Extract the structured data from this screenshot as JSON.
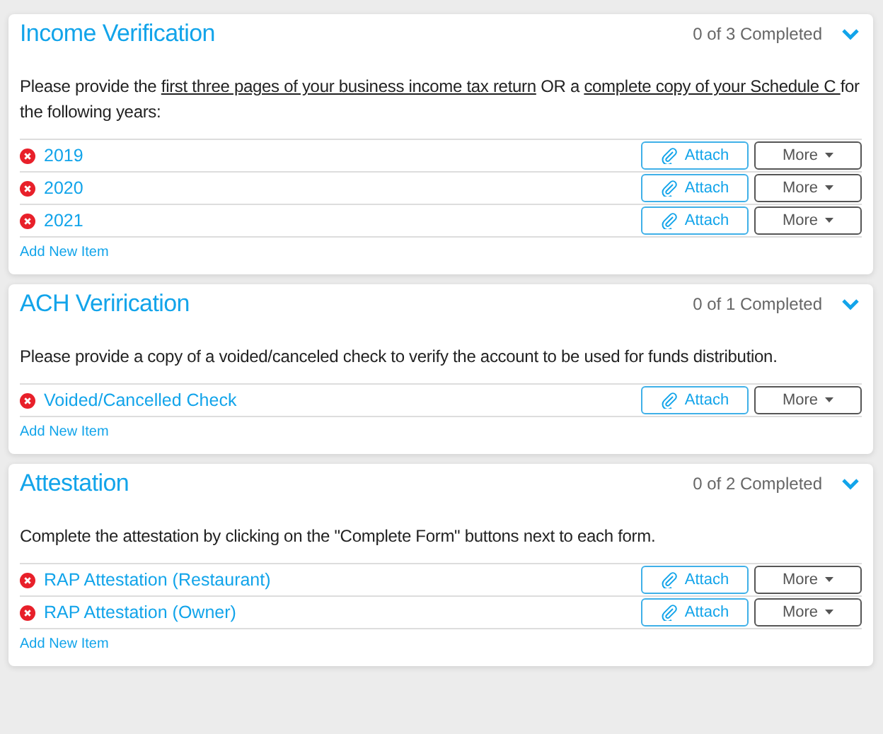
{
  "sections": [
    {
      "title": "Income Verification",
      "progress": "0 of 3 Completed",
      "expanded": true,
      "description": [
        {
          "text": "Please provide the ",
          "underlined": false
        },
        {
          "text": "first three pages of your business income tax return",
          "underlined": true
        },
        {
          "text": " OR a ",
          "underlined": false
        },
        {
          "text": "complete copy of your Schedule C ",
          "underlined": true
        },
        {
          "text": "for the following years:",
          "underlined": false
        }
      ],
      "items": [
        {
          "label": "2019",
          "completed": false,
          "attach": "Attach",
          "more": "More"
        },
        {
          "label": "2020",
          "completed": false,
          "attach": "Attach",
          "more": "More"
        },
        {
          "label": "2021",
          "completed": false,
          "attach": "Attach",
          "more": "More"
        }
      ],
      "add_link": "Add New Item"
    },
    {
      "title": "ACH Verirication",
      "progress": "0 of 1 Completed",
      "expanded": true,
      "description": [
        {
          "text": "Please provide a copy of a voided/canceled check to verify the account to be used for funds distribution.",
          "underlined": false
        }
      ],
      "items": [
        {
          "label": "Voided/Cancelled Check",
          "completed": false,
          "attach": "Attach",
          "more": "More"
        }
      ],
      "add_link": "Add New Item"
    },
    {
      "title": "Attestation",
      "progress": "0 of 2 Completed",
      "expanded": true,
      "description": [
        {
          "text": "Complete the attestation by clicking on the \"Complete Form\" buttons next to each form.",
          "underlined": false
        }
      ],
      "items": [
        {
          "label": "RAP Attestation (Restaurant)",
          "completed": false,
          "attach": "Attach",
          "more": "More"
        },
        {
          "label": "RAP Attestation (Owner)",
          "completed": false,
          "attach": "Attach",
          "more": "More"
        }
      ],
      "add_link": "Add New Item"
    }
  ]
}
